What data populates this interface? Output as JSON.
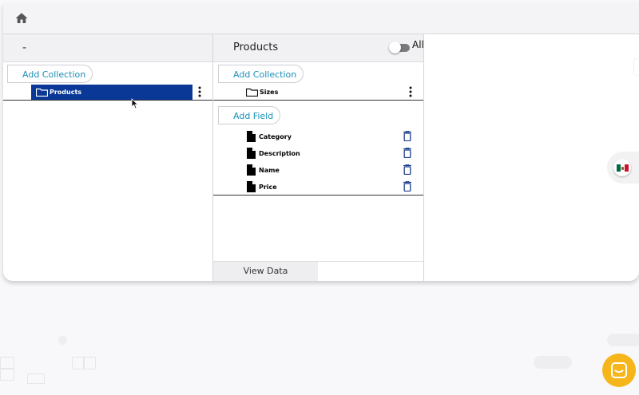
{
  "topbar": {
    "home_icon": "home-icon"
  },
  "left_column": {
    "header": "-",
    "add_collection_label": "Add Collection",
    "collections": [
      {
        "label": "Products",
        "selected": true
      }
    ]
  },
  "middle_column": {
    "header": "Products",
    "toggle_label": "All",
    "toggle_on": false,
    "add_collection_label": "Add Collection",
    "collections": [
      {
        "label": "Sizes"
      }
    ],
    "add_field_label": "Add Field",
    "fields": [
      {
        "label": "Category"
      },
      {
        "label": "Description"
      },
      {
        "label": "Name"
      },
      {
        "label": "Price"
      }
    ],
    "view_data_label": "View Data"
  },
  "language": {
    "flag": "mexico-flag",
    "colors": [
      "#006847",
      "#ffffff",
      "#ce1126"
    ]
  },
  "colors": {
    "accent": "#1a8fb8",
    "selected": "#0a3896",
    "chat": "#f7b51c"
  }
}
